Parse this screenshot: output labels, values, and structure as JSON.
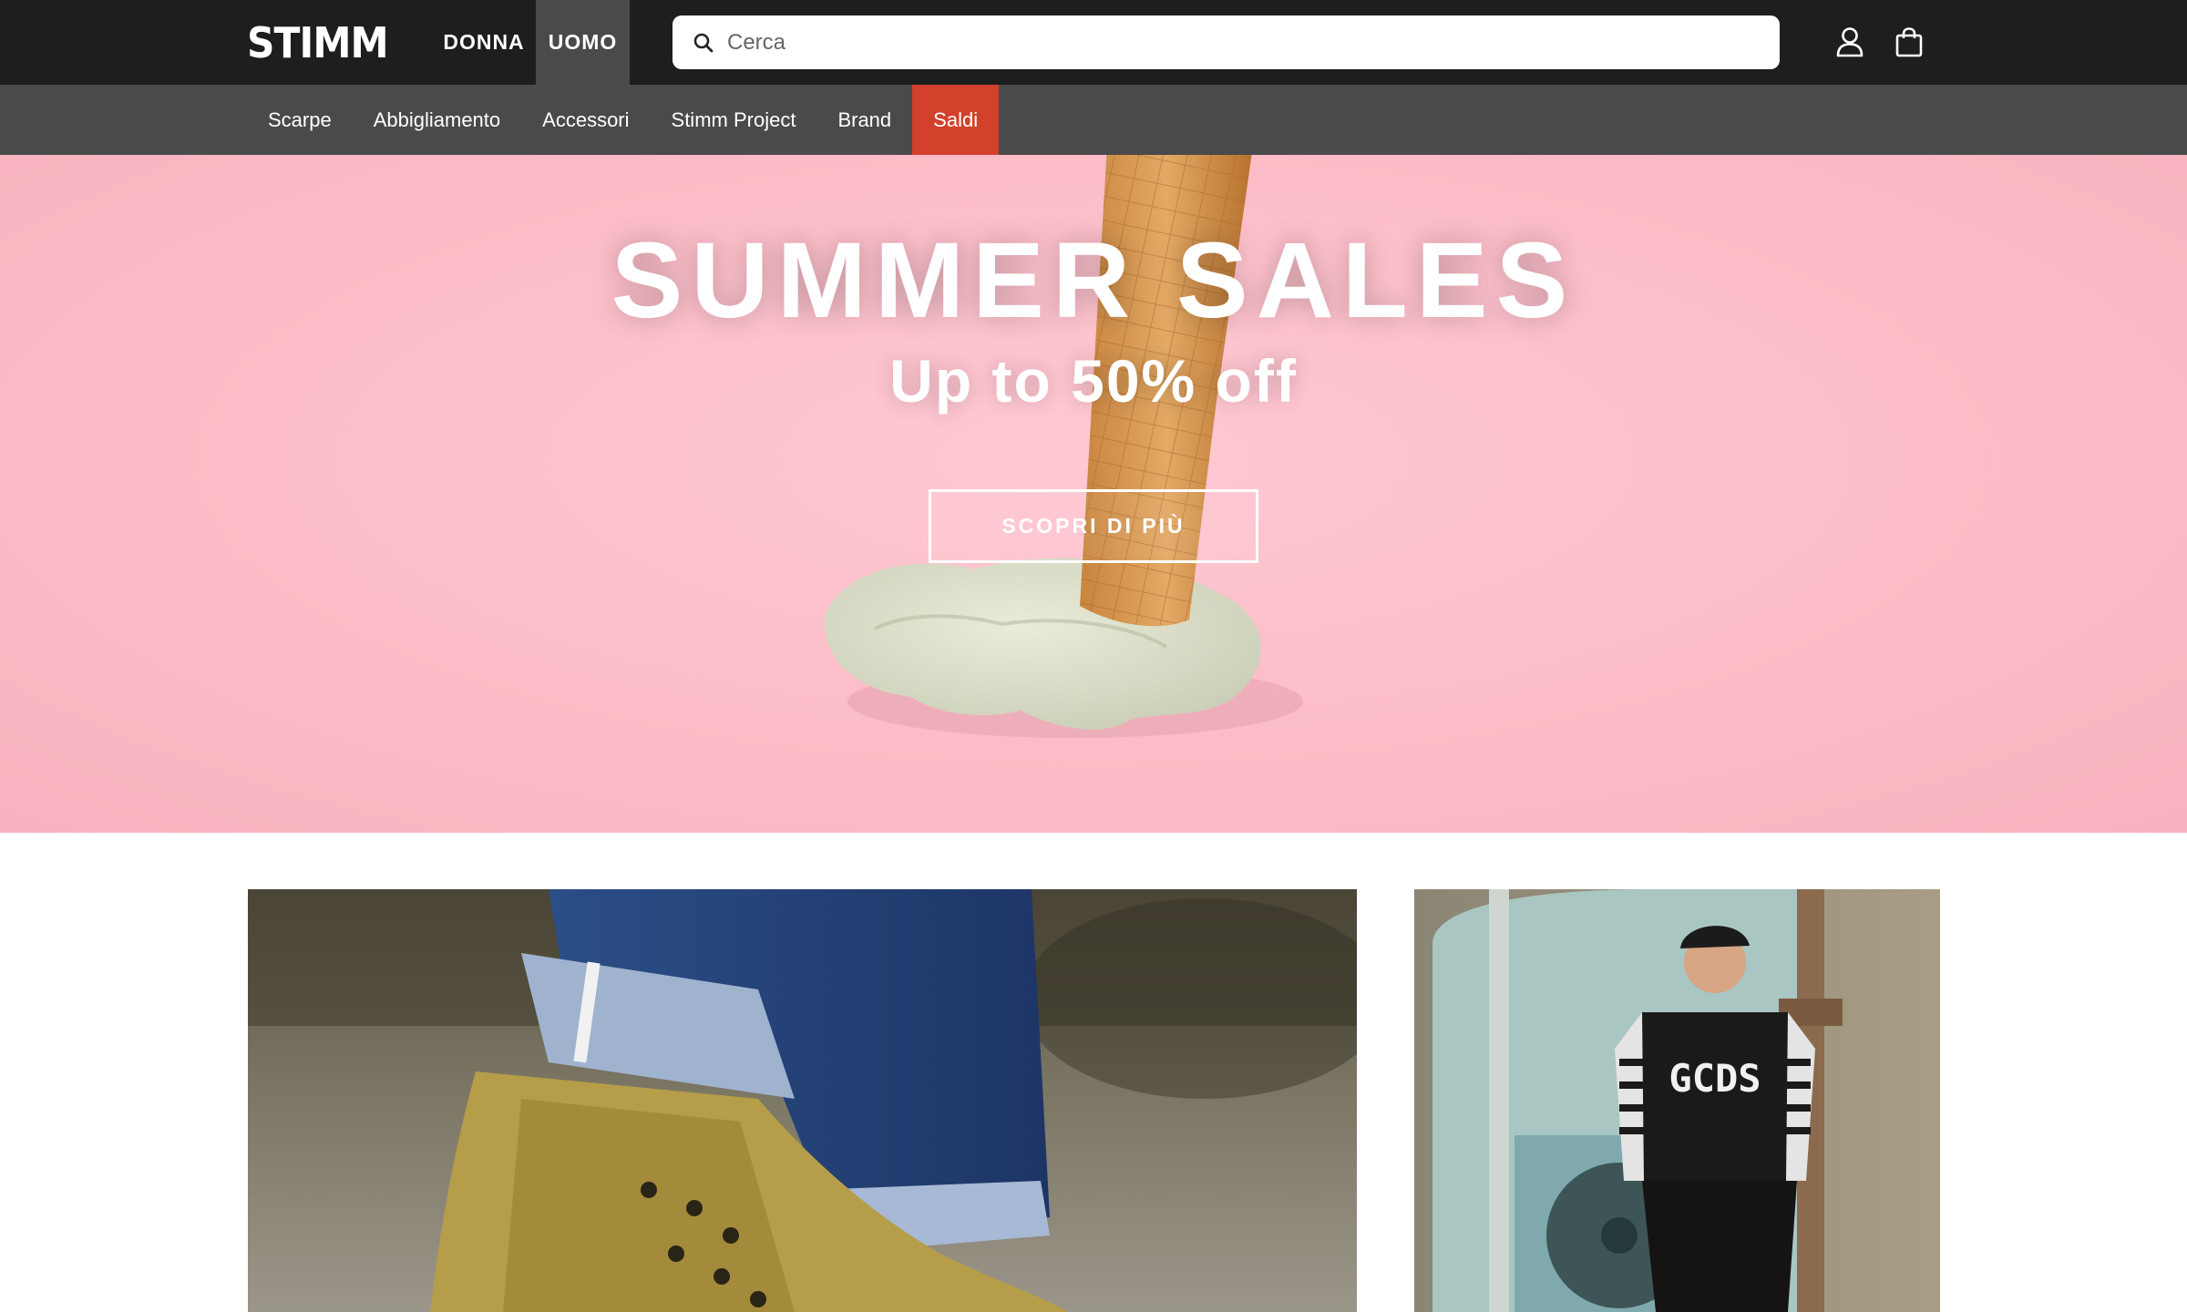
{
  "brand": {
    "logo_text": "STIMM"
  },
  "header": {
    "gender_tabs": [
      {
        "label": "DONNA",
        "active": false
      },
      {
        "label": "UOMO",
        "active": true
      }
    ],
    "search": {
      "placeholder": "Cerca",
      "icon": "search-icon"
    },
    "icons": [
      "user-icon",
      "shopping-bag-icon"
    ]
  },
  "nav": {
    "items": [
      {
        "label": "Scarpe"
      },
      {
        "label": "Abbigliamento"
      },
      {
        "label": "Accessori"
      },
      {
        "label": "Stimm Project"
      },
      {
        "label": "Brand"
      },
      {
        "label": "Saldi",
        "highlight": true
      }
    ]
  },
  "hero": {
    "title": "SUMMER SALES",
    "subtitle": "Up to 50% off",
    "cta_label": "SCOPRI DI PIÙ"
  },
  "promos": {
    "right_shirt_print": "GCDS"
  },
  "colors": {
    "topbar": "#1e1e1e",
    "navbar": "#4a4a4a",
    "sale_accent": "#d2412b",
    "hero_pink": "#fbbcc7"
  }
}
